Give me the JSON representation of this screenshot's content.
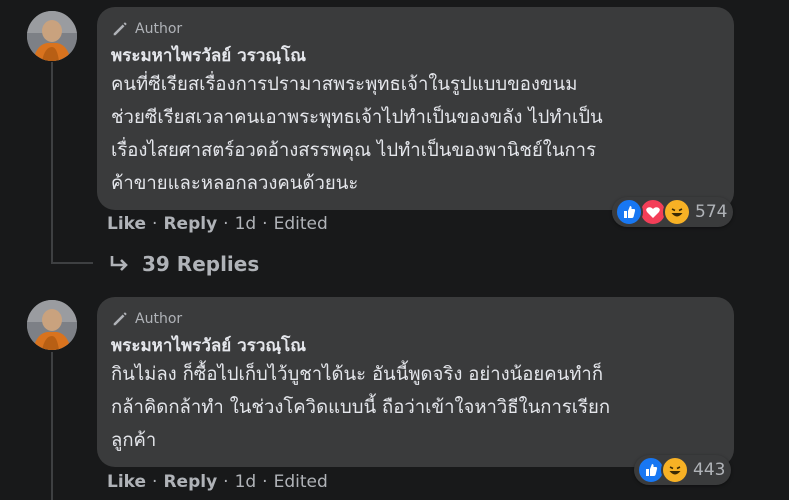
{
  "comments": [
    {
      "author_badge": "Author",
      "name": "พระมหาไพรวัลย์ วรวณฺโณ",
      "text": "คนที่ซีเรียสเรื่องการปรามาสพระพุทธเจ้าในรูปแบบของขนม\nช่วยซีเรียสเวลาคนเอาพระพุทธเจ้าไปทำเป็นของขลัง ไปทำเป็น\nเรื่องไสยศาสตร์อวดอ้างสรรพคุณ ไปทำเป็นของพานิชย์ในการ\nค้าขายและหลอกลวงคนด้วยนะ",
      "like_label": "Like",
      "reply_label": "Reply",
      "time": "1d",
      "edited": "Edited",
      "reaction_count": "574",
      "reactions": [
        "like-icon",
        "love-icon",
        "haha-icon"
      ]
    },
    {
      "author_badge": "Author",
      "name": "พระมหาไพรวัลย์ วรวณฺโณ",
      "text": "กินไม่ลง ก็ซื้อไปเก็บไว้บูชาได้นะ อันนี้พูดจริง อย่างน้อยคนทำก็\nกล้าคิดกล้าทำ ในช่วงโควิดแบบนี้ ถือว่าเข้าใจหาวิธีในการเรียก\nลูกค้า",
      "like_label": "Like",
      "reply_label": "Reply",
      "time": "1d",
      "edited": "Edited",
      "reaction_count": "443",
      "reactions": [
        "like-icon",
        "haha-icon"
      ]
    }
  ],
  "replies_link": "39 Replies",
  "colors": {
    "background": "#18191a",
    "bubble": "#3a3b3c",
    "text": "#e4e6eb",
    "muted": "#b0b3b8",
    "like": "#1877f2",
    "love": "#f33e58",
    "haha": "#f7b125"
  }
}
